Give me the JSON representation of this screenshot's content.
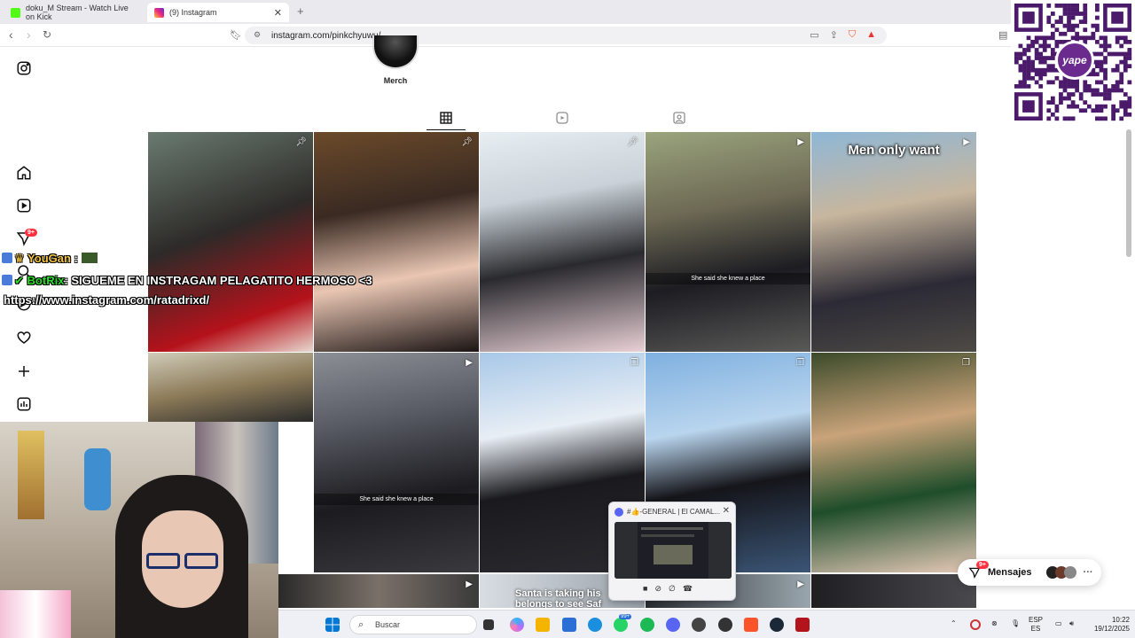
{
  "browser": {
    "tabs": [
      {
        "title": "doku_M Stream - Watch Live on Kick",
        "active": false,
        "favicon_color": "#53fc18"
      },
      {
        "title": "(9) Instagram",
        "active": true,
        "favicon_color": "#d62976"
      }
    ],
    "url": "instagram.com/pinkchyuwu/"
  },
  "sidebar": {
    "notification_badge": "9+",
    "items": [
      "instagram-logo-icon",
      "home-icon",
      "reels-icon",
      "messages-icon",
      "search-icon",
      "explore-icon",
      "notifications-icon",
      "create-icon",
      "dashboard-icon"
    ]
  },
  "profile": {
    "highlight_label": "Merch",
    "tabs": [
      "grid-icon",
      "reels-icon",
      "tagged-icon"
    ]
  },
  "posts": [
    {
      "overlay_top": "",
      "caption": "",
      "icon": "pin"
    },
    {
      "overlay_top": "",
      "caption": "",
      "icon": "pin"
    },
    {
      "overlay_top": "",
      "caption": "",
      "icon": "pin"
    },
    {
      "overlay_top": "",
      "caption": "She said she knew a place",
      "icon": "reel"
    },
    {
      "overlay_top": "Men only want",
      "caption": "",
      "icon": "reel"
    },
    {
      "overlay_top": "",
      "caption": "",
      "icon": ""
    },
    {
      "overlay_top": "",
      "caption": "She said she knew a place",
      "icon": "reel"
    },
    {
      "overlay_top": "",
      "caption": "",
      "icon": "carousel"
    },
    {
      "overlay_top": "",
      "caption": "",
      "icon": "carousel"
    },
    {
      "overlay_top": "",
      "caption": "",
      "icon": "carousel"
    }
  ],
  "bottom_row_text": "Santa is taking his\nbelongs to see Saf",
  "chat": {
    "line1_user": "YouGan",
    "line1_sep": ":",
    "line2_user": "BotRix",
    "line2_text": ": SIGUEME EN INSTRAGAM PELAGATITO HERMOSO <3",
    "line3_text": "https://www.instagram.com/ratadrixd/"
  },
  "discord_popup": {
    "title": "#👍-GENERAL | El CAMAL..."
  },
  "messages_pill": {
    "label": "Mensajes",
    "badge": "9+"
  },
  "qr": {
    "brand": "yape"
  },
  "taskbar": {
    "search_placeholder": "Buscar",
    "whatsapp_badge": "99+",
    "lang_top": "ESP",
    "lang_bottom": "ES",
    "time": "10:22",
    "date": "19/12/2025"
  }
}
